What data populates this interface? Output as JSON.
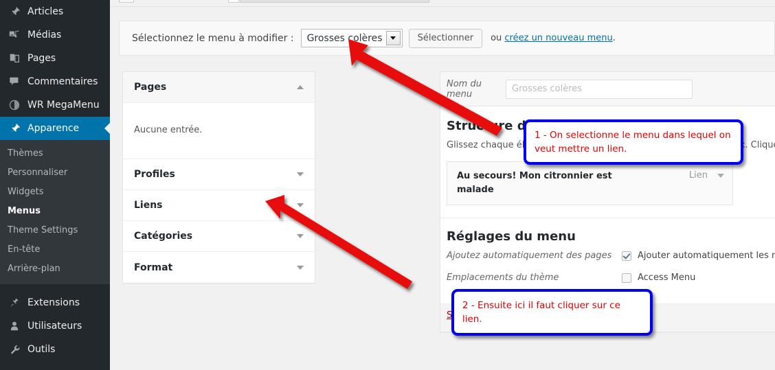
{
  "sidebar": {
    "top_items": [
      {
        "label": "Articles",
        "icon": "pin-icon",
        "current": false
      },
      {
        "label": "Médias",
        "icon": "media-icon",
        "current": false
      },
      {
        "label": "Pages",
        "icon": "pages-icon",
        "current": false
      },
      {
        "label": "Commentaires",
        "icon": "comment-icon",
        "current": false
      },
      {
        "label": "WR MegaMenu",
        "icon": "megamenu-icon",
        "current": false
      },
      {
        "label": "Apparence",
        "icon": "appearance-brush-icon",
        "current": true
      }
    ],
    "submenu": [
      {
        "label": "Thèmes",
        "current": false
      },
      {
        "label": "Personnaliser",
        "current": false
      },
      {
        "label": "Widgets",
        "current": false
      },
      {
        "label": "Menus",
        "current": true
      },
      {
        "label": "Theme Settings",
        "current": false
      },
      {
        "label": "En-tête",
        "current": false
      },
      {
        "label": "Arrière-plan",
        "current": false
      }
    ],
    "bottom_items": [
      {
        "label": "Extensions",
        "icon": "plugin-icon"
      },
      {
        "label": "Utilisateurs",
        "icon": "user-icon"
      },
      {
        "label": "Outils",
        "icon": "wrench-icon"
      }
    ],
    "accent_color": "#0073aa",
    "background_color": "#23282d",
    "submenu_background_color": "#32373c"
  },
  "selector_bar": {
    "label": "Sélectionnez le menu à modifier :",
    "select_value": "Grosses colères",
    "select_button": "Sélectionner",
    "or_prefix": "ou ",
    "create_link": "créez un nouveau menu",
    "or_suffix": ".",
    "link_color": "#0073aa"
  },
  "accordion": {
    "panels": [
      {
        "label": "Pages",
        "open": true,
        "empty_text": "Aucune entrée."
      },
      {
        "label": "Profiles",
        "open": false
      },
      {
        "label": "Liens",
        "open": false
      },
      {
        "label": "Catégories",
        "open": false
      },
      {
        "label": "Format",
        "open": false
      }
    ]
  },
  "main_panel": {
    "name_label": "Nom du menu",
    "name_placeholder": "Grosses colères",
    "structure_heading": "Structure du menu",
    "structure_hint": "Glissez chaque élément pour les placer dans l'ordre de votre choix. Cliquez sur la flèche de l'é",
    "menu_item": {
      "title": "Au secours! Mon citronnier est malade",
      "type": "Lien"
    },
    "settings_heading": "Réglages du menu",
    "settings": [
      {
        "label": "Ajoutez automatiquement des pages",
        "checkbox_label": "Ajouter automatiquement les nouvelles pages principales de",
        "checked": true
      },
      {
        "label": "Emplacements du thème",
        "checkbox_label": "Access Menu",
        "checked": false
      }
    ],
    "delete_link": "Supprimer le menu",
    "delete_color": "#a00"
  },
  "annotations": {
    "callout_1": "1 - On selectionne le menu dans lequel on veut mettre un lien.",
    "callout_2": "2 - Ensuite ici il faut cliquer sur ce lien.",
    "border_color": "#0000ee",
    "text_color": "#e00000",
    "arrow_color": "#e81111"
  }
}
